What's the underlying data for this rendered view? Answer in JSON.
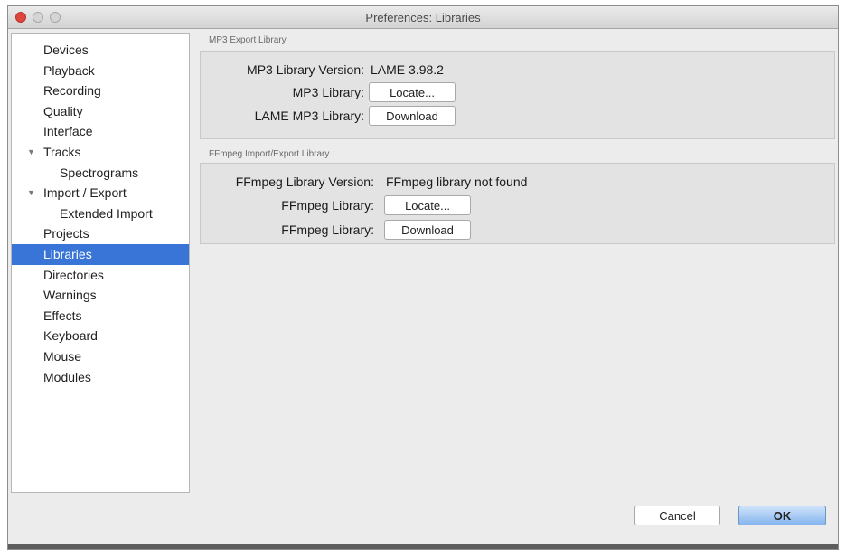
{
  "window": {
    "title": "Preferences: Libraries"
  },
  "sidebar": {
    "items": [
      {
        "label": "Devices"
      },
      {
        "label": "Playback"
      },
      {
        "label": "Recording"
      },
      {
        "label": "Quality"
      },
      {
        "label": "Interface"
      },
      {
        "label": "Tracks",
        "disclosure": "▼"
      },
      {
        "label": "Spectrograms"
      },
      {
        "label": "Import / Export",
        "disclosure": "▼"
      },
      {
        "label": "Extended Import"
      },
      {
        "label": "Projects"
      },
      {
        "label": "Libraries",
        "selected": true
      },
      {
        "label": "Directories"
      },
      {
        "label": "Warnings"
      },
      {
        "label": "Effects"
      },
      {
        "label": "Keyboard"
      },
      {
        "label": "Mouse"
      },
      {
        "label": "Modules"
      }
    ]
  },
  "mp3": {
    "title": "MP3 Export Library",
    "version_label": "MP3 Library Version:",
    "version_value": "LAME 3.98.2",
    "library_label": "MP3 Library:",
    "locate_label": "Locate...",
    "lame_label": "LAME MP3 Library:",
    "download_label": "Download"
  },
  "ffmpeg": {
    "title": "FFmpeg Import/Export Library",
    "version_label": "FFmpeg Library Version:",
    "version_value": "FFmpeg library not found",
    "library_label": "FFmpeg Library:",
    "locate_label": "Locate...",
    "library2_label": "FFmpeg Library:",
    "download_label": "Download"
  },
  "footer": {
    "cancel_label": "Cancel",
    "ok_label": "OK"
  }
}
